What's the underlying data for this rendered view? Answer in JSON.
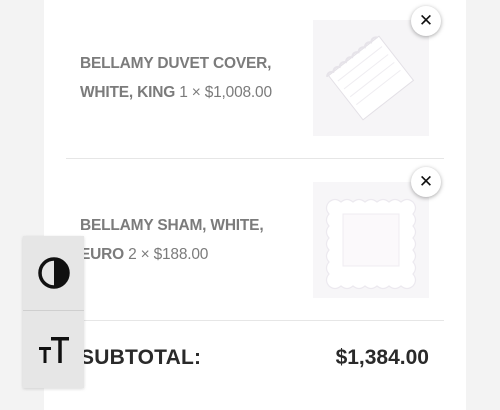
{
  "cart": {
    "items": [
      {
        "name": "BELLAMY DUVET COVER, WHITE, KING",
        "quantity_price": "1 × $1,008.00",
        "thumbnail_icon": "duvet-cover-thumbnail",
        "remove_icon": "close-icon"
      },
      {
        "name": "BELLAMY SHAM, WHITE, EURO",
        "quantity_price": "2 × $188.00",
        "thumbnail_icon": "pillow-sham-thumbnail",
        "remove_icon": "close-icon"
      }
    ],
    "subtotal_label": "SUBTOTAL:",
    "subtotal_value": "$1,384.00"
  },
  "accessibility_toolbar": {
    "buttons": [
      {
        "icon": "contrast-icon"
      },
      {
        "icon": "text-size-icon"
      }
    ]
  },
  "colors": {
    "page_background": "#f3f3f3",
    "panel_background": "#ffffff",
    "item_text": "#7b7b7b",
    "subtotal_text": "#2a2a2a",
    "toolbar_background": "#e6e6e6"
  }
}
